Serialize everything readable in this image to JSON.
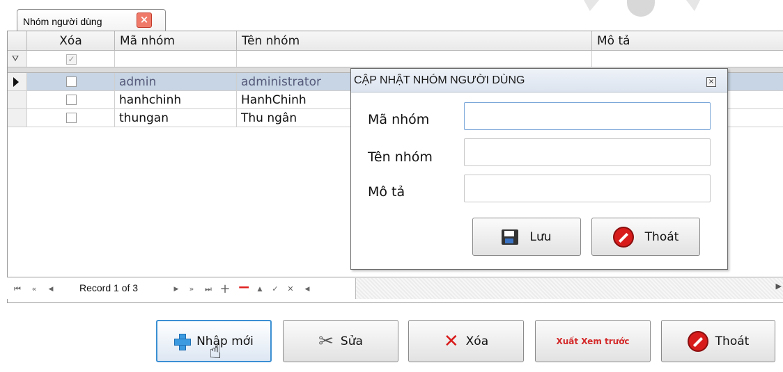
{
  "tab": {
    "label": "Nhóm người dùng"
  },
  "grid": {
    "columns": [
      "Xóa",
      "Mã nhóm",
      "Tên nhóm",
      "Mô tả"
    ],
    "rows": [
      {
        "deleted": false,
        "code": "admin",
        "name": "administrator",
        "desc": ""
      },
      {
        "deleted": false,
        "code": "hanhchinh",
        "name": "HanhChinh",
        "desc": ""
      },
      {
        "deleted": false,
        "code": "thungan",
        "name": "Thu ngân",
        "desc": ""
      }
    ],
    "selected_row": 0
  },
  "navigator": {
    "record_text": "Record 1 of 3",
    "buttons": [
      "first",
      "prev-page",
      "prev",
      "next",
      "next-page",
      "last",
      "append",
      "delete",
      "edit",
      "post",
      "cancel"
    ]
  },
  "buttons": {
    "new": "Nhập mới",
    "edit": "Sửa",
    "delete": "Xóa",
    "preview": "Xuất Xem trước",
    "exit": "Thoát"
  },
  "dialog": {
    "title": "CẬP NHẬT NHÓM NGƯỜI DÙNG",
    "fields": {
      "code_label": "Mã nhóm",
      "code_value": "",
      "name_label": "Tên nhóm",
      "name_value": "",
      "desc_label": "Mô tả",
      "desc_value": ""
    },
    "save_label": "Lưu",
    "exit_label": "Thoát"
  }
}
